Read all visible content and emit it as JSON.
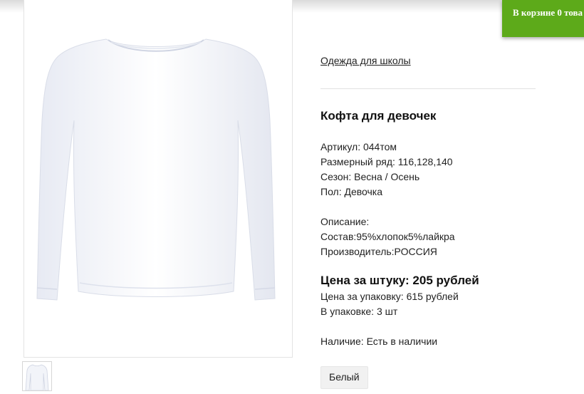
{
  "cart": {
    "label": "В корзине",
    "count": "0",
    "suffix": "това"
  },
  "product": {
    "breadcrumb": "Одежда для школы",
    "title": "Кофта для девочек",
    "article": "Артикул: 044том",
    "sizes": "Размерный ряд: 116,128,140",
    "season": "Сезон: Весна / Осень",
    "gender": "Пол: Девочка",
    "description_label": "Описание:",
    "composition": "Состав:95%хлопок5%лайкра",
    "manufacturer": "Производитель:РОССИЯ",
    "price_unit": "Цена за штуку: 205 рублей",
    "price_pack": "Цена за упаковку: 615 рублей",
    "pack_qty": "В упаковке: 3 шт",
    "availability": "Наличие: Есть в наличии",
    "color_option": "Белый"
  },
  "icons": {
    "main_image": "white-longsleeve-shirt-image",
    "thumbnail": "white-longsleeve-shirt-thumbnail"
  }
}
